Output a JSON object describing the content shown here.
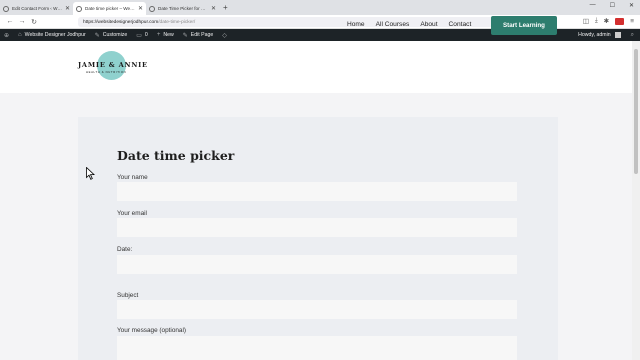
{
  "browser": {
    "tabs": [
      {
        "label": "Edit Contact Form ‹ Website De"
      },
      {
        "label": "Date time picker – Website De"
      },
      {
        "label": "Date Time Picker for Contact F"
      }
    ],
    "new_tab": "+",
    "url_host": "https://websitedesignerjodhpur.com",
    "url_path": "/date-time-picker/",
    "zoom": "120%"
  },
  "adminbar": {
    "site_name": "Website Designer Jodhpur",
    "customize": "Customize",
    "comments_count": "0",
    "new_label": "New",
    "edit_page": "Edit Page",
    "howdy": "Howdy, admin"
  },
  "header": {
    "logo_name": "JAMIE & ANNIE",
    "logo_sub": "HEALTH & NUTRITION",
    "menu": [
      "Home",
      "All Courses",
      "About",
      "Contact"
    ],
    "cta": "Start Learning"
  },
  "form": {
    "title": "Date time picker",
    "fields": [
      {
        "label": "Your name"
      },
      {
        "label": "Your email"
      },
      {
        "label": "Date:"
      },
      {
        "label": "Subject"
      },
      {
        "label": "Your message (optional)"
      }
    ]
  },
  "colors": {
    "brand": "#2d7d6e",
    "logo_circle": "#8fd1ce",
    "adminbar": "#1d2327"
  }
}
